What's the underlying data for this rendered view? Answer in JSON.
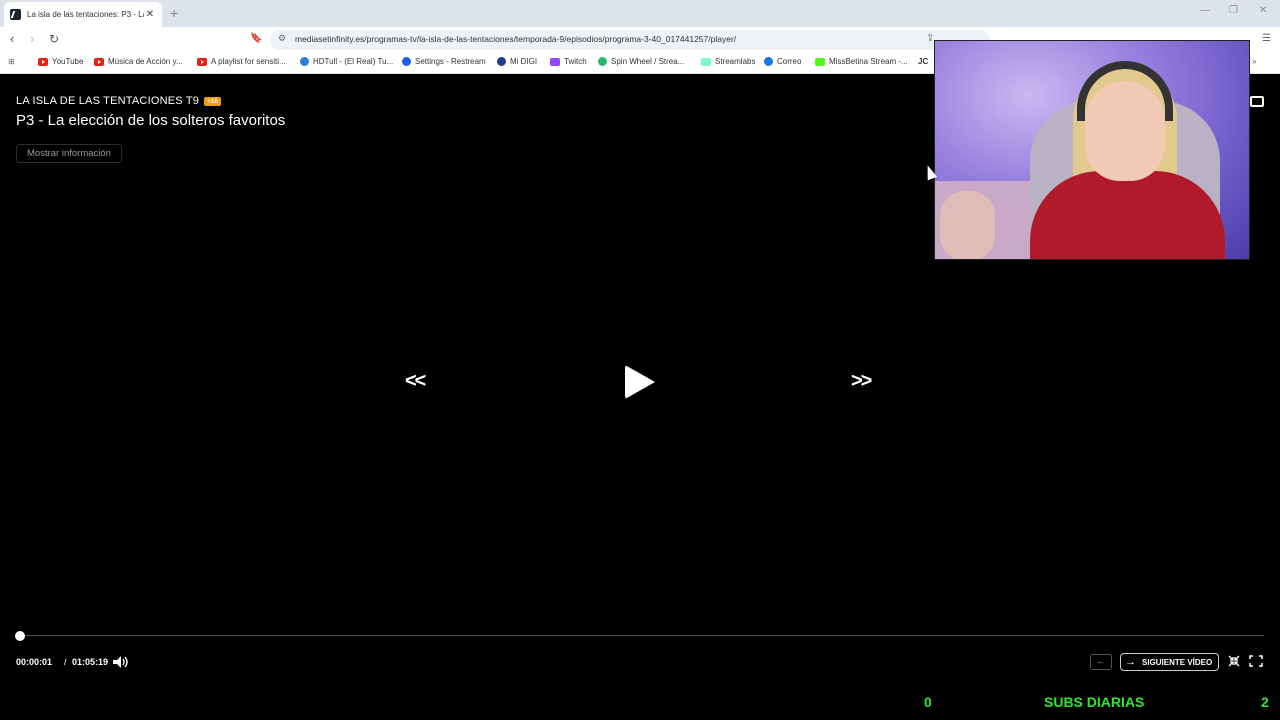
{
  "browser": {
    "tab_title": "La isla de las tentaciones: P3 - La",
    "tab_close": "✕",
    "new_tab": "+",
    "url": "mediasetinfinity.es/programas-tv/la-isla-de-las-tentaciones/temporada-9/episodios/programa-3-40_017441257/player/",
    "bookmarks": [
      {
        "label": "YouTube",
        "icon": "youtube-icon"
      },
      {
        "label": "Música de Acción y...",
        "icon": "youtube-icon"
      },
      {
        "label": "A playlist for sensiti...",
        "icon": "youtube-icon"
      },
      {
        "label": "HDTull - (El Real) Tu...",
        "icon": "link-icon"
      },
      {
        "label": "Settings - Restream",
        "icon": "restream-icon"
      },
      {
        "label": "Mi DIGI",
        "icon": "digi-icon"
      },
      {
        "label": "Twitch",
        "icon": "twitch-icon"
      },
      {
        "label": "Spin Wheel / Strea...",
        "icon": "wheel-icon"
      },
      {
        "label": "Streamlabs",
        "icon": "streamlabs-icon"
      },
      {
        "label": "Correo",
        "icon": "mail-icon"
      },
      {
        "label": "MissBetina Stream -...",
        "icon": "kick-icon"
      },
      {
        "label": "JC",
        "icon": "jc-icon"
      }
    ]
  },
  "player": {
    "show_title": "LA ISLA DE LAS TENTACIONES T9",
    "rating": "+16",
    "episode_title": "P3 - La elección de los solteros favoritos",
    "info_button": "Mostrar información",
    "rewind": "<<",
    "forward": ">>",
    "time_current": "00:00:01",
    "time_separator": "/",
    "time_total": "01:05:19",
    "progress": 0.0,
    "next_label": "SIGUIENTE VÍDEO"
  },
  "overlay": {
    "counter_left": "0",
    "subs_label": "SUBS DIARIAS",
    "counter_right": "2",
    "accent_color": "#2ee62e"
  }
}
